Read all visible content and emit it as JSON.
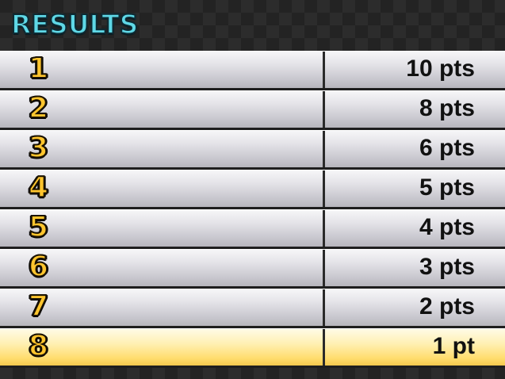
{
  "header": {
    "title": "RESULTS"
  },
  "colors": {
    "title": "#5fd8e6",
    "rank_number": "#ffc52e",
    "row_normal": "#e4e3e8",
    "row_highlight": "#ffdd6e",
    "points_text": "#111111"
  },
  "results": {
    "rows": [
      {
        "rank": "1",
        "points": "10 pts",
        "highlight": false
      },
      {
        "rank": "2",
        "points": "8 pts",
        "highlight": false
      },
      {
        "rank": "3",
        "points": "6 pts",
        "highlight": false
      },
      {
        "rank": "4",
        "points": "5 pts",
        "highlight": false
      },
      {
        "rank": "5",
        "points": "4 pts",
        "highlight": false
      },
      {
        "rank": "6",
        "points": "3 pts",
        "highlight": false
      },
      {
        "rank": "7",
        "points": "2 pts",
        "highlight": false
      },
      {
        "rank": "8",
        "points": "1 pt",
        "highlight": true
      }
    ]
  }
}
